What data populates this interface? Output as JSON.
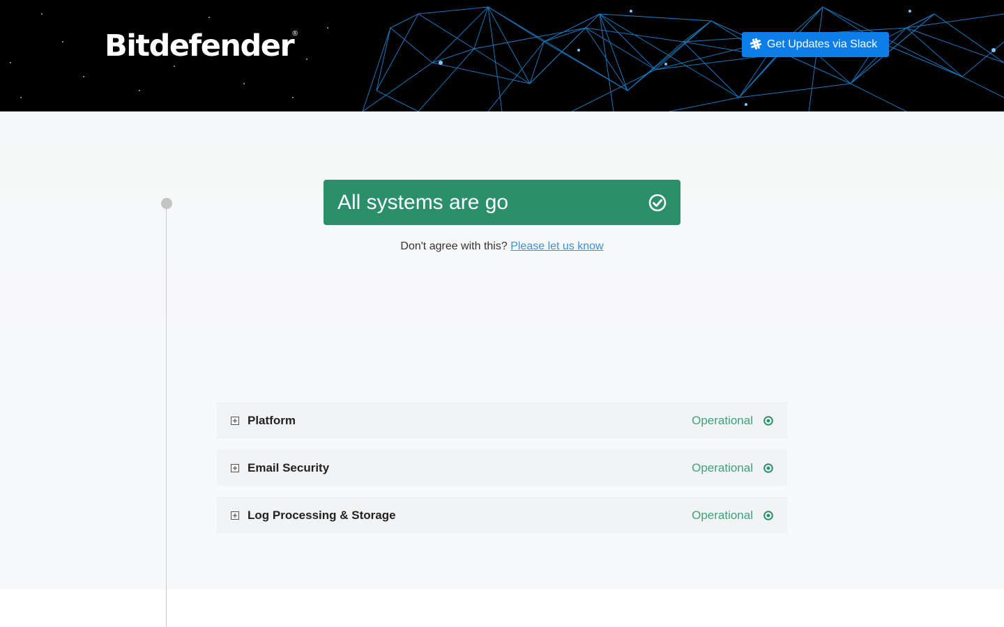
{
  "header": {
    "logo_text": "Bitdefender",
    "logo_reg": "®",
    "slack_button_label": "Get Updates via Slack"
  },
  "status": {
    "message": "All systems are go",
    "icon": "check-circle-icon",
    "color": "#2a8f6a"
  },
  "feedback": {
    "prompt": "Don't agree with this?",
    "link_text": "Please let us know"
  },
  "components": [
    {
      "name": "Platform",
      "status": "Operational"
    },
    {
      "name": "Email Security",
      "status": "Operational"
    },
    {
      "name": "Log Processing & Storage",
      "status": "Operational"
    }
  ],
  "colors": {
    "operational": "#3fa07a",
    "accent_button": "#0d7ee8",
    "link": "#3a8fd9"
  }
}
